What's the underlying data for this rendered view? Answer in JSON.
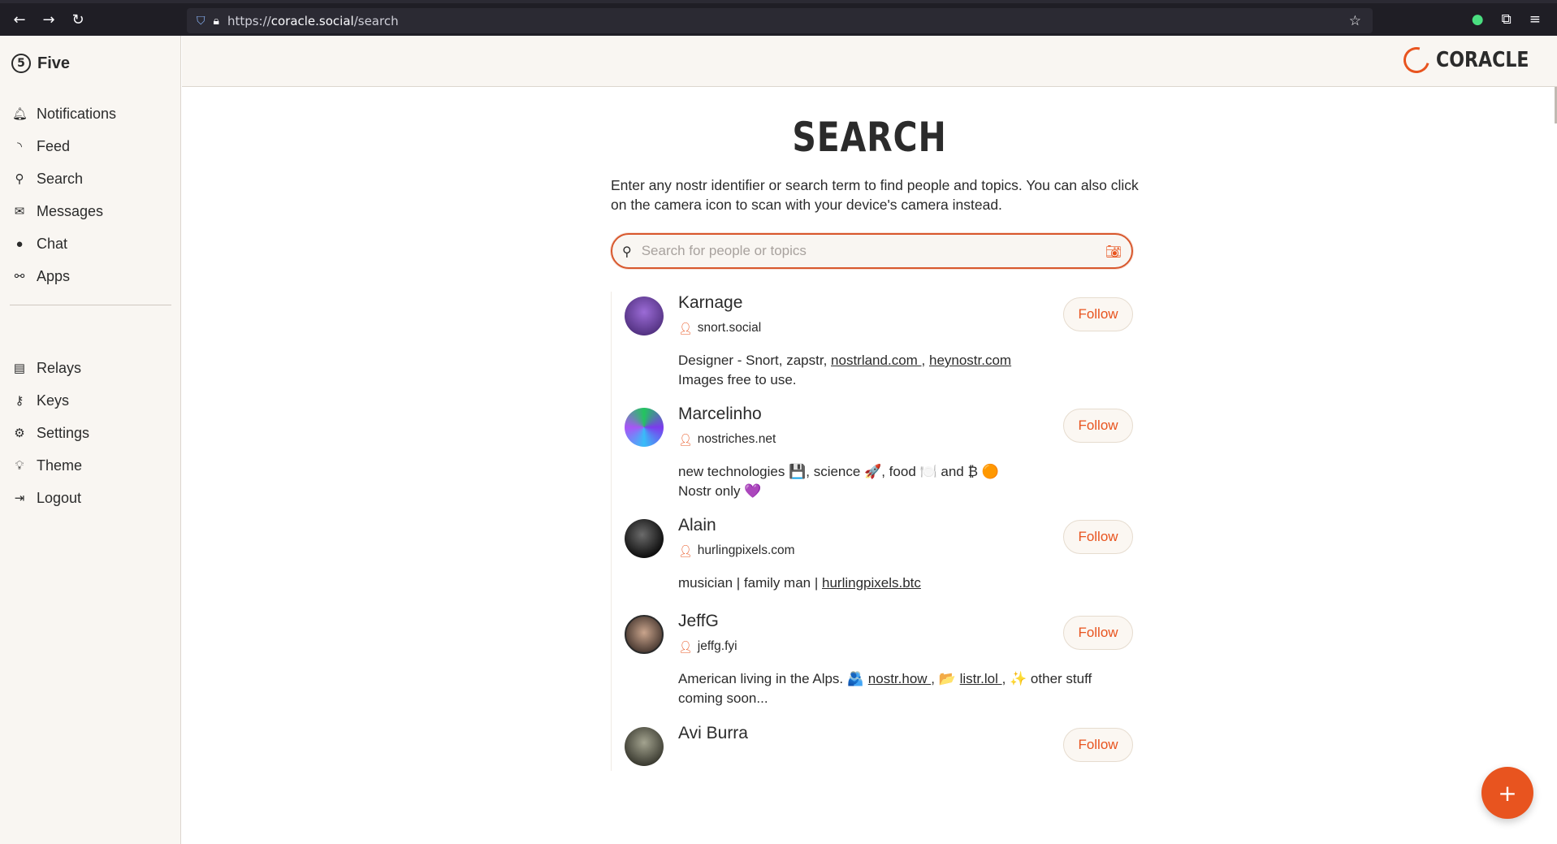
{
  "browser": {
    "url_scheme": "https://",
    "url_host": "coracle.social",
    "url_path": "/search"
  },
  "sidebar": {
    "brand": "Five",
    "primary_items": [
      {
        "label": "Notifications",
        "icon": "bell-icon"
      },
      {
        "label": "Feed",
        "icon": "rss-icon"
      },
      {
        "label": "Search",
        "icon": "search-icon"
      },
      {
        "label": "Messages",
        "icon": "envelope-icon"
      },
      {
        "label": "Chat",
        "icon": "chat-bubble-icon"
      },
      {
        "label": "Apps",
        "icon": "bicycle-icon"
      }
    ],
    "secondary_items": [
      {
        "label": "Relays",
        "icon": "server-icon"
      },
      {
        "label": "Keys",
        "icon": "key-icon"
      },
      {
        "label": "Settings",
        "icon": "gear-icon"
      },
      {
        "label": "Theme",
        "icon": "lightbulb-icon"
      },
      {
        "label": "Logout",
        "icon": "logout-icon"
      }
    ]
  },
  "header": {
    "logo_text": "CORACLE"
  },
  "main": {
    "title": "SEARCH",
    "intro": "Enter any nostr identifier or search term to find people and topics. You can also click on the camera icon to scan with your device's camera instead.",
    "search": {
      "placeholder": "Search for people or topics",
      "value": ""
    },
    "results": [
      {
        "name": "Karnage",
        "nip05": "snort.social",
        "bio_line1_parts": [
          "Designer - Snort, zapstr, ",
          "nostrland.com ",
          ", ",
          "heynostr.com"
        ],
        "bio_line2": "Images free to use.",
        "follow_label": "Follow",
        "avatar_color": "#6b3fa0"
      },
      {
        "name": "Marcelinho",
        "nip05": "nostriches.net",
        "bio_line1": "new technologies 💾, science 🚀, food 🍽️ and ₿ 🟠",
        "bio_line2": "Nostr only 💜",
        "follow_label": "Follow",
        "avatar_color": "#7c3aed"
      },
      {
        "name": "Alain",
        "nip05": "hurlingpixels.com",
        "bio_parts": [
          "musician | family man | ",
          "hurlingpixels.btc"
        ],
        "follow_label": "Follow",
        "avatar_color": "#1f1f1f"
      },
      {
        "name": "JeffG",
        "nip05": "jeffg.fyi",
        "bio_parts": [
          "American living in the Alps. 🫂 ",
          "nostr.how ",
          ", 📂 ",
          "listr.lol ",
          ", ✨ other stuff"
        ],
        "bio_line2": "coming soon...",
        "follow_label": "Follow",
        "avatar_color": "#8a6a5a"
      },
      {
        "name": "Avi Burra",
        "follow_label": "Follow",
        "avatar_color": "#7a7a6a"
      }
    ]
  },
  "fab_label": "+",
  "colors": {
    "accent": "#e8541f",
    "sidebar_bg": "#f9f6f2"
  }
}
